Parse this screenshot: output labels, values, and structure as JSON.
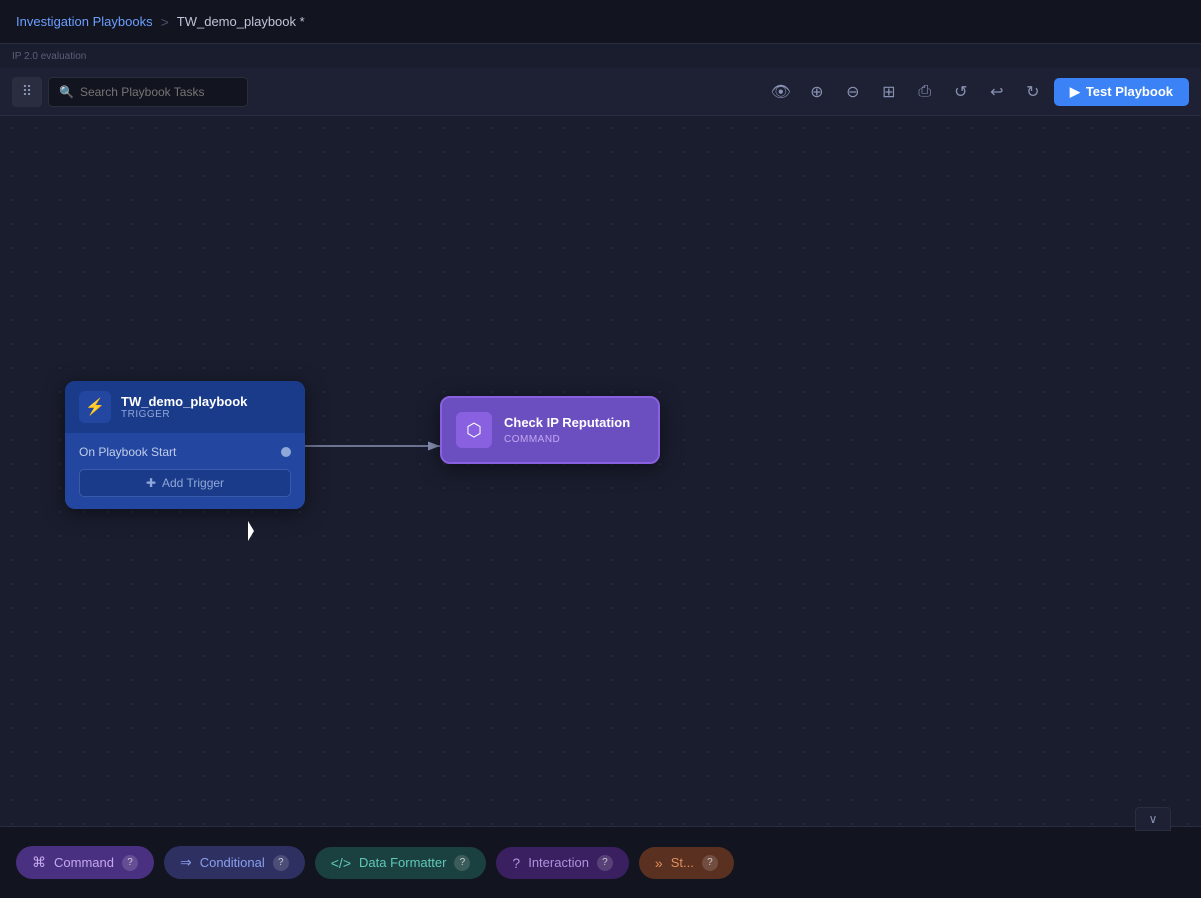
{
  "topnav": {
    "breadcrumb_parent": "Investigation Playbooks",
    "breadcrumb_sep": ">",
    "breadcrumb_current": "TW_demo_playbook *"
  },
  "breadcrumb_sub": "IP 2.0 evaluation",
  "toolbar": {
    "search_placeholder": "Search Playbook Tasks",
    "test_playbook_label": "Test Playbook",
    "icons": {
      "eye": "👁",
      "zoom_in": "⊕",
      "zoom_out": "⊖",
      "fit": "⊞",
      "print": "⎙",
      "refresh": "↺",
      "undo": "↩",
      "redo": "↻"
    }
  },
  "nodes": {
    "trigger": {
      "title": "TW_demo_playbook",
      "subtitle": "TRIGGER",
      "trigger_label": "On Playbook Start",
      "add_trigger_label": "Add Trigger"
    },
    "command": {
      "title": "Check IP Reputation",
      "subtitle": "COMMAND"
    }
  },
  "bottom_panel": {
    "toggle_icon": "∨",
    "items": [
      {
        "id": "command",
        "icon": "⌘",
        "label": "Command",
        "help": "?"
      },
      {
        "id": "conditional",
        "icon": "⇒",
        "label": "Conditional",
        "help": "?"
      },
      {
        "id": "dataformatter",
        "icon": "</>",
        "label": "Data Formatter",
        "help": "?"
      },
      {
        "id": "interaction",
        "icon": "?",
        "label": "Interaction",
        "help": "?"
      },
      {
        "id": "step",
        "icon": "»",
        "label": "St...",
        "help": "?"
      }
    ]
  }
}
